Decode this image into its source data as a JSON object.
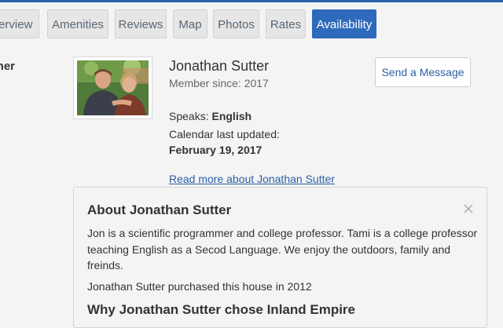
{
  "tabs": [
    "verview",
    "Amenities",
    "Reviews",
    "Map",
    "Photos",
    "Rates",
    "Availability"
  ],
  "active_tab": "Availability",
  "section_label": "wner",
  "owner": {
    "name": "Jonathan Sutter",
    "member_since": "Member since: 2017",
    "speaks_label": "Speaks:",
    "speaks_value": "English",
    "calendar_label": "Calendar last updated:",
    "calendar_date": "February 19, 2017",
    "read_more": "Read more about Jonathan Sutter",
    "send_message": "Send a Message"
  },
  "about": {
    "title": "About Jonathan Sutter",
    "bio": "Jon is a scientific programmer and college professor. Tami is a college professor teaching English as a Secod Language. We enjoy the outdoors, family and freinds.",
    "purchase": "Jonathan Sutter purchased this house in 2012",
    "why_title": "Why Jonathan Sutter chose Inland Empire"
  },
  "colors": {
    "accent": "#2e6abb",
    "link": "#2b5fa6",
    "tab_bg": "#e6e6e6",
    "page_bg": "#f4f4f4"
  },
  "icons": {
    "close": "close-icon"
  }
}
